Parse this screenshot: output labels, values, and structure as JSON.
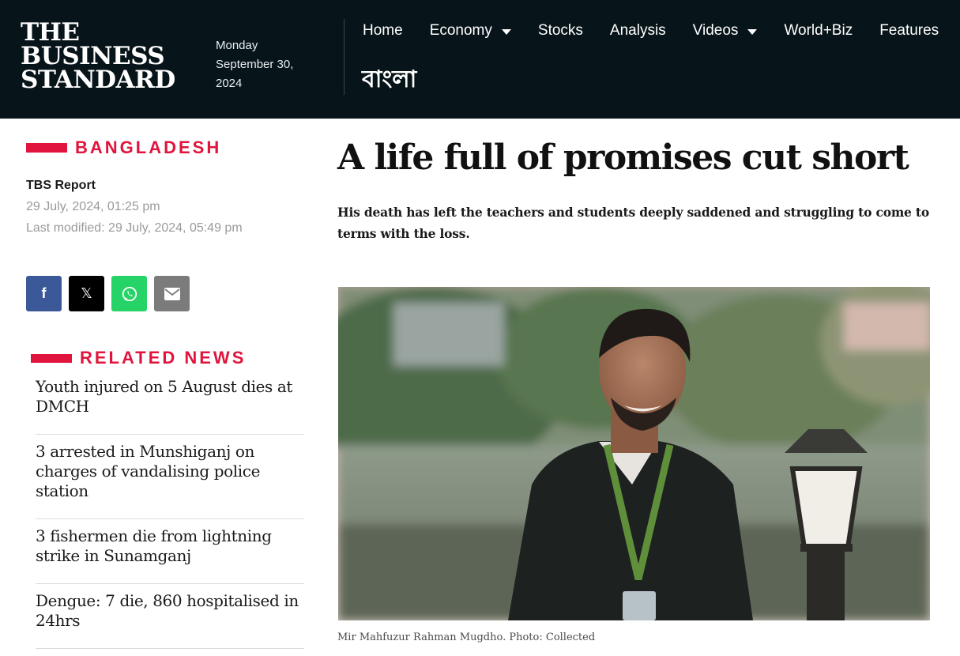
{
  "header": {
    "logo_lines": [
      "The",
      "Business",
      "Standard"
    ],
    "date_weekday": "Monday",
    "date_line": "September 30,",
    "date_year": "2024",
    "nav": [
      {
        "label": "Home",
        "has_caret": false
      },
      {
        "label": "Economy",
        "has_caret": true
      },
      {
        "label": "Stocks",
        "has_caret": false
      },
      {
        "label": "Analysis",
        "has_caret": false
      },
      {
        "label": "Videos",
        "has_caret": true
      },
      {
        "label": "World+Biz",
        "has_caret": false
      },
      {
        "label": "Features",
        "has_caret": false
      }
    ],
    "bangla_link": "বাংলা"
  },
  "article": {
    "section": "BANGLADESH",
    "author": "TBS Report",
    "published": "29 July, 2024, 01:25 pm",
    "modified": "Last modified: 29 July, 2024, 05:49 pm",
    "headline": "A life full of promises cut short",
    "subheadline": "His death has left the teachers and students deeply saddened and struggling to come to terms with the loss.",
    "photo_caption": "Mir Mahfuzur Rahman Mugdho. Photo: Collected"
  },
  "share": {
    "facebook_glyph": "f",
    "x_glyph": "𝕏",
    "whatsapp_icon": "whatsapp-icon",
    "email_icon": "email-icon"
  },
  "related": {
    "title": "RELATED NEWS",
    "items": [
      "Youth injured on 5 August dies at DMCH",
      "3 arrested in Munshiganj on charges of vandalising police station",
      "3 fishermen die from lightning strike in Sunamganj",
      "Dengue: 7 die, 860 hospitalised in 24hrs"
    ]
  },
  "colors": {
    "header_bg": "#071419",
    "accent_red": "#e0143c",
    "facebook": "#3b5998",
    "whatsapp": "#25d366",
    "email": "#7b7b7b"
  }
}
